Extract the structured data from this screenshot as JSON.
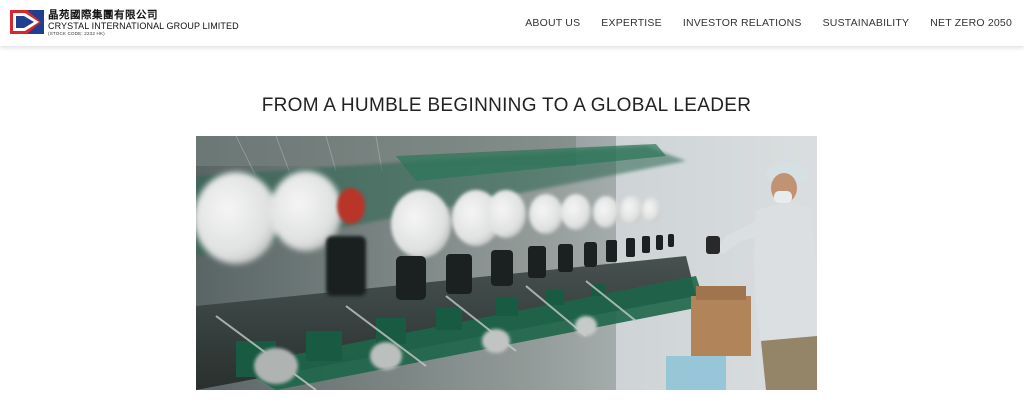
{
  "brand": {
    "name_cn": "晶苑國際集團有限公司",
    "name_en": "CRYSTAL INTERNATIONAL GROUP LIMITED",
    "stock_code": "(STOCK CODE: 2232 HK)"
  },
  "nav": {
    "items": [
      {
        "label": "ABOUT US"
      },
      {
        "label": "EXPERTISE"
      },
      {
        "label": "INVESTOR RELATIONS"
      },
      {
        "label": "SUSTAINABILITY"
      },
      {
        "label": "NET ZERO 2050"
      }
    ]
  },
  "hero": {
    "title": "FROM A HUMBLE BEGINNING TO A GLOBAL LEADER"
  },
  "colors": {
    "logo_red": "#d7262c",
    "logo_blue": "#1f3f8f",
    "text": "#222222"
  }
}
